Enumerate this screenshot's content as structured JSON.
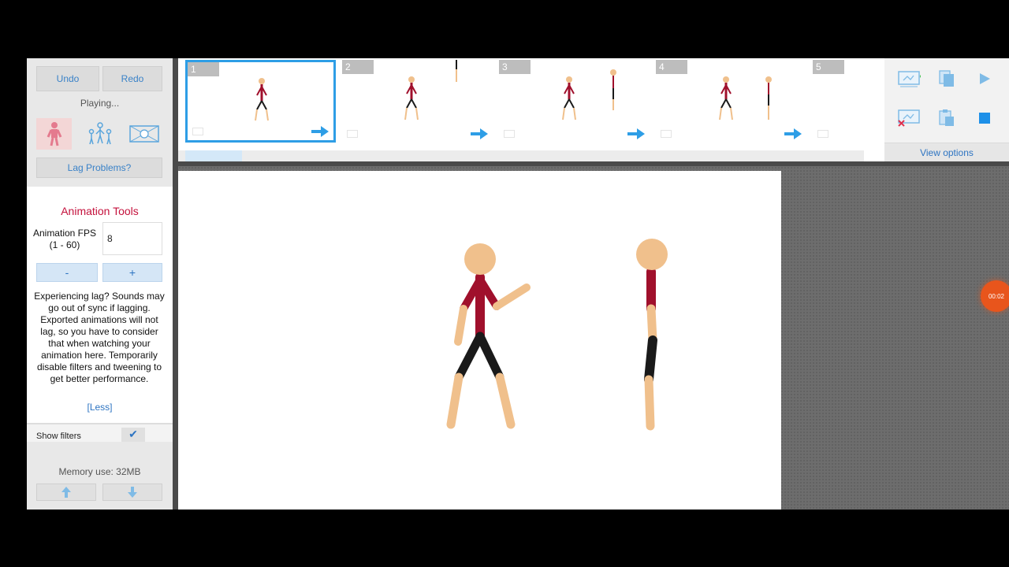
{
  "toolbar": {
    "undo_label": "Undo",
    "redo_label": "Redo"
  },
  "status": {
    "playing": "Playing..."
  },
  "modes": [
    {
      "icon": "single-figure-icon"
    },
    {
      "icon": "multiple-figures-icon"
    },
    {
      "icon": "background-image-icon"
    }
  ],
  "lag_button": {
    "label": "Lag Problems?"
  },
  "animation_tools": {
    "title": "Animation Tools",
    "fps_label": "Animation FPS (1 - 60)",
    "fps_value": "8",
    "minus_label": "-",
    "plus_label": "+",
    "lag_text": "Experiencing lag? Sounds may go out of sync if lagging. Exported animations will not lag, so you have to consider that when watching your animation here. Temporarily disable filters and tweening to get better performance.",
    "less_link": "[Less]"
  },
  "filters": {
    "label": "Show filters",
    "checked": true
  },
  "memory": {
    "label": "Memory use: 32MB"
  },
  "frames": [
    {
      "number": "1",
      "selected": true
    },
    {
      "number": "2",
      "selected": false
    },
    {
      "number": "3",
      "selected": false
    },
    {
      "number": "4",
      "selected": false
    },
    {
      "number": "5",
      "selected": false
    }
  ],
  "right_controls": {
    "view_options": "View options",
    "icons": [
      "add-frame-icon",
      "copy-frame-icon",
      "play-icon",
      "delete-frame-icon",
      "paste-frame-icon",
      "stop-icon"
    ]
  },
  "timer": {
    "label": "00:02"
  },
  "colors": {
    "accent_blue": "#2e9ee6",
    "title_red": "#c4113c",
    "figure_red": "#a0102c",
    "skin": "#f0c08c",
    "pants": "#1a1a1a",
    "timer": "#e8551c"
  }
}
